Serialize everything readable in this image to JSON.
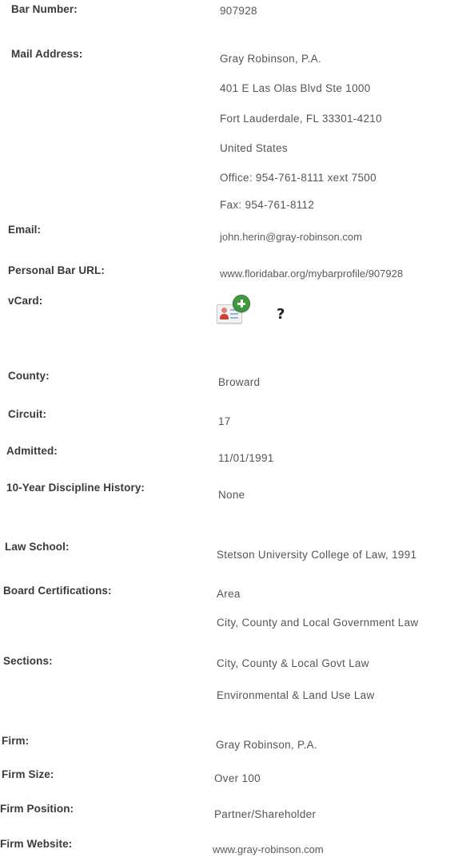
{
  "profile": {
    "bar_number": {
      "label": "Bar Number:",
      "value": "907928"
    },
    "mail_address": {
      "label": "Mail Address:",
      "lines": [
        "Gray Robinson, P.A.",
        "401 E Las Olas Blvd Ste 1000",
        "Fort Lauderdale, FL 33301-4210",
        "United States",
        "Office: 954-761-8111 xext 7500",
        "Fax: 954-761-8112"
      ]
    },
    "email": {
      "label": "Email:",
      "value": "john.herin@gray-robinson.com"
    },
    "personal_bar_url": {
      "label": "Personal Bar URL:",
      "value": "www.floridabar.org/mybarprofile/907928"
    },
    "vcard": {
      "label": "vCard:",
      "help": "?",
      "icon": "vcard-add-icon"
    },
    "county": {
      "label": "County:",
      "value": "Broward"
    },
    "circuit": {
      "label": "Circuit:",
      "value": "17"
    },
    "admitted": {
      "label": "Admitted:",
      "value": "11/01/1991"
    },
    "discipline": {
      "label": "10-Year Discipline History:",
      "value": "None"
    },
    "law_school": {
      "label": "Law School:",
      "value": "Stetson University College of Law, 1991"
    },
    "board_certifications": {
      "label": "Board Certifications:",
      "area_header": "Area",
      "areas": [
        "City, County and Local Government Law"
      ]
    },
    "sections": {
      "label": "Sections:",
      "values": [
        "City, County & Local Govt Law",
        "Environmental & Land Use Law"
      ]
    },
    "firm": {
      "label": "Firm:",
      "value": "Gray Robinson, P.A."
    },
    "firm_size": {
      "label": "Firm Size:",
      "value": "Over 100"
    },
    "firm_position": {
      "label": "Firm Position:",
      "value": "Partner/Shareholder"
    },
    "firm_website": {
      "label": "Firm Website:",
      "value": "www.gray-robinson.com"
    }
  },
  "colors": {
    "label_text": "#3a3a3a",
    "value_text": "#555555",
    "plus_badge": "#3f9a3f",
    "header_fragment": "#4f79b8"
  }
}
